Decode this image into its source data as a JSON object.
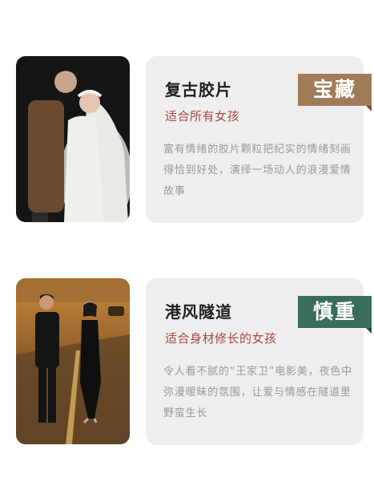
{
  "colors": {
    "badge_1": "#a07b58",
    "badge_2": "#3a6e5b",
    "subtitle": "#a84740",
    "card_bg": "#eeeeee"
  },
  "items": [
    {
      "title": "复古胶片",
      "badge": "宝藏",
      "subtitle": "适合所有女孩",
      "description": "富有情绪的胶片颗粒把纪实的情绪刻画得恰到好处，演绎一场动人的浪漫爱情故事",
      "photo": "wedding-couple-photo"
    },
    {
      "title": "港风隧道",
      "badge": "慎重",
      "subtitle": "适合身材修长的女孩",
      "description": "令人看不腻的“王家卫”电影美，夜色中弥漫暧昧的氛围，让爱与情感在隧道里野蛮生长",
      "photo": "tunnel-couple-photo"
    }
  ]
}
